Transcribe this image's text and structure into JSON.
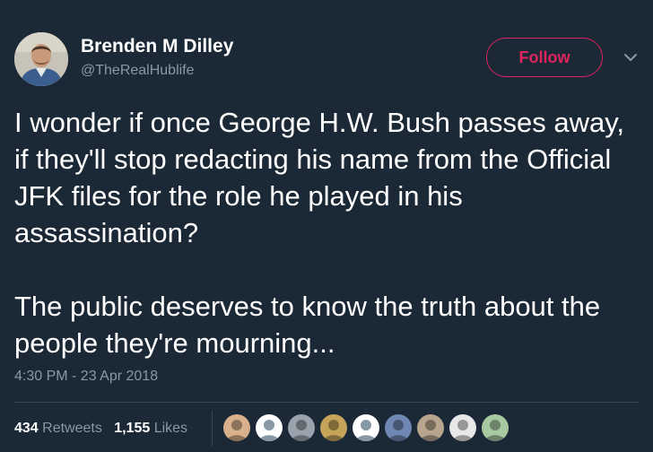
{
  "author": {
    "name": "Brenden M Dilley",
    "handle": "@TheRealHublife"
  },
  "follow_label": "Follow",
  "tweet": {
    "paragraphs": [
      "I wonder if once George H.W. Bush passes away, if they'll stop redacting his name from the Official JFK files for the role he played in his assassination?",
      "The public deserves to know the truth about the people they're mourning..."
    ],
    "timestamp": "4:30 PM - 23 Apr 2018"
  },
  "stats": {
    "retweets_count": "434",
    "retweets_label": "Retweets",
    "likes_count": "1,155",
    "likes_label": "Likes"
  },
  "colors": {
    "background": "#1b2836",
    "text": "#ffffff",
    "secondary_text": "#8899a6",
    "follow_accent": "#e0245e",
    "divider": "#38444d"
  },
  "likers": [
    {
      "icon": "user-avatar-icon",
      "color": "#d8b08c"
    },
    {
      "icon": "default-avatar-icon",
      "color": "#8899a6"
    },
    {
      "icon": "user-avatar-icon",
      "color": "#9aa3ad"
    },
    {
      "icon": "user-avatar-icon",
      "color": "#c5a45a"
    },
    {
      "icon": "default-avatar-icon",
      "color": "#8899a6"
    },
    {
      "icon": "user-avatar-icon",
      "color": "#6f87b3"
    },
    {
      "icon": "user-avatar-icon",
      "color": "#b7a58e"
    },
    {
      "icon": "user-avatar-icon",
      "color": "#e8e8e8"
    },
    {
      "icon": "user-avatar-icon",
      "color": "#a8c8a0"
    }
  ]
}
